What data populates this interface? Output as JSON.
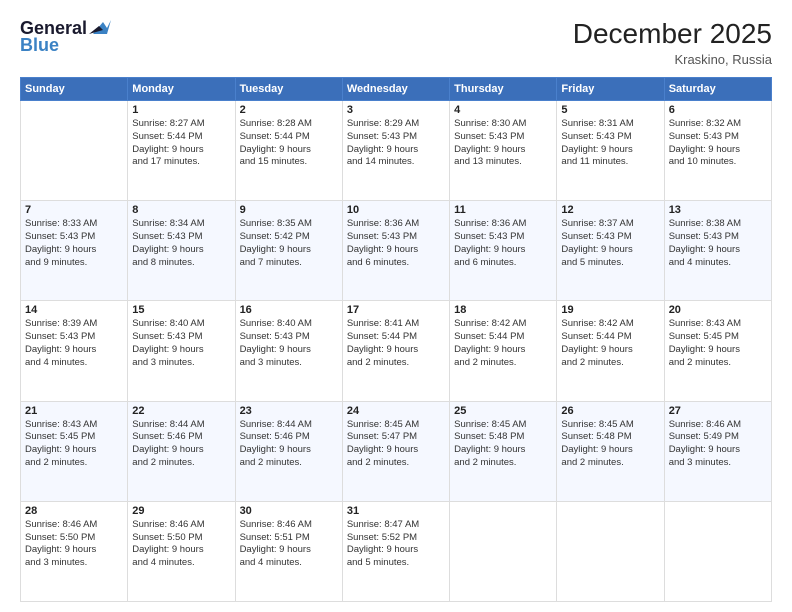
{
  "logo": {
    "line1": "General",
    "line2": "Blue"
  },
  "title": "December 2025",
  "location": "Kraskino, Russia",
  "days_of_week": [
    "Sunday",
    "Monday",
    "Tuesday",
    "Wednesday",
    "Thursday",
    "Friday",
    "Saturday"
  ],
  "weeks": [
    [
      {
        "day": "",
        "info": ""
      },
      {
        "day": "1",
        "info": "Sunrise: 8:27 AM\nSunset: 5:44 PM\nDaylight: 9 hours\nand 17 minutes."
      },
      {
        "day": "2",
        "info": "Sunrise: 8:28 AM\nSunset: 5:44 PM\nDaylight: 9 hours\nand 15 minutes."
      },
      {
        "day": "3",
        "info": "Sunrise: 8:29 AM\nSunset: 5:43 PM\nDaylight: 9 hours\nand 14 minutes."
      },
      {
        "day": "4",
        "info": "Sunrise: 8:30 AM\nSunset: 5:43 PM\nDaylight: 9 hours\nand 13 minutes."
      },
      {
        "day": "5",
        "info": "Sunrise: 8:31 AM\nSunset: 5:43 PM\nDaylight: 9 hours\nand 11 minutes."
      },
      {
        "day": "6",
        "info": "Sunrise: 8:32 AM\nSunset: 5:43 PM\nDaylight: 9 hours\nand 10 minutes."
      }
    ],
    [
      {
        "day": "7",
        "info": "Sunrise: 8:33 AM\nSunset: 5:43 PM\nDaylight: 9 hours\nand 9 minutes."
      },
      {
        "day": "8",
        "info": "Sunrise: 8:34 AM\nSunset: 5:43 PM\nDaylight: 9 hours\nand 8 minutes."
      },
      {
        "day": "9",
        "info": "Sunrise: 8:35 AM\nSunset: 5:42 PM\nDaylight: 9 hours\nand 7 minutes."
      },
      {
        "day": "10",
        "info": "Sunrise: 8:36 AM\nSunset: 5:43 PM\nDaylight: 9 hours\nand 6 minutes."
      },
      {
        "day": "11",
        "info": "Sunrise: 8:36 AM\nSunset: 5:43 PM\nDaylight: 9 hours\nand 6 minutes."
      },
      {
        "day": "12",
        "info": "Sunrise: 8:37 AM\nSunset: 5:43 PM\nDaylight: 9 hours\nand 5 minutes."
      },
      {
        "day": "13",
        "info": "Sunrise: 8:38 AM\nSunset: 5:43 PM\nDaylight: 9 hours\nand 4 minutes."
      }
    ],
    [
      {
        "day": "14",
        "info": "Sunrise: 8:39 AM\nSunset: 5:43 PM\nDaylight: 9 hours\nand 4 minutes."
      },
      {
        "day": "15",
        "info": "Sunrise: 8:40 AM\nSunset: 5:43 PM\nDaylight: 9 hours\nand 3 minutes."
      },
      {
        "day": "16",
        "info": "Sunrise: 8:40 AM\nSunset: 5:43 PM\nDaylight: 9 hours\nand 3 minutes."
      },
      {
        "day": "17",
        "info": "Sunrise: 8:41 AM\nSunset: 5:44 PM\nDaylight: 9 hours\nand 2 minutes."
      },
      {
        "day": "18",
        "info": "Sunrise: 8:42 AM\nSunset: 5:44 PM\nDaylight: 9 hours\nand 2 minutes."
      },
      {
        "day": "19",
        "info": "Sunrise: 8:42 AM\nSunset: 5:44 PM\nDaylight: 9 hours\nand 2 minutes."
      },
      {
        "day": "20",
        "info": "Sunrise: 8:43 AM\nSunset: 5:45 PM\nDaylight: 9 hours\nand 2 minutes."
      }
    ],
    [
      {
        "day": "21",
        "info": "Sunrise: 8:43 AM\nSunset: 5:45 PM\nDaylight: 9 hours\nand 2 minutes."
      },
      {
        "day": "22",
        "info": "Sunrise: 8:44 AM\nSunset: 5:46 PM\nDaylight: 9 hours\nand 2 minutes."
      },
      {
        "day": "23",
        "info": "Sunrise: 8:44 AM\nSunset: 5:46 PM\nDaylight: 9 hours\nand 2 minutes."
      },
      {
        "day": "24",
        "info": "Sunrise: 8:45 AM\nSunset: 5:47 PM\nDaylight: 9 hours\nand 2 minutes."
      },
      {
        "day": "25",
        "info": "Sunrise: 8:45 AM\nSunset: 5:48 PM\nDaylight: 9 hours\nand 2 minutes."
      },
      {
        "day": "26",
        "info": "Sunrise: 8:45 AM\nSunset: 5:48 PM\nDaylight: 9 hours\nand 2 minutes."
      },
      {
        "day": "27",
        "info": "Sunrise: 8:46 AM\nSunset: 5:49 PM\nDaylight: 9 hours\nand 3 minutes."
      }
    ],
    [
      {
        "day": "28",
        "info": "Sunrise: 8:46 AM\nSunset: 5:50 PM\nDaylight: 9 hours\nand 3 minutes."
      },
      {
        "day": "29",
        "info": "Sunrise: 8:46 AM\nSunset: 5:50 PM\nDaylight: 9 hours\nand 4 minutes."
      },
      {
        "day": "30",
        "info": "Sunrise: 8:46 AM\nSunset: 5:51 PM\nDaylight: 9 hours\nand 4 minutes."
      },
      {
        "day": "31",
        "info": "Sunrise: 8:47 AM\nSunset: 5:52 PM\nDaylight: 9 hours\nand 5 minutes."
      },
      {
        "day": "",
        "info": ""
      },
      {
        "day": "",
        "info": ""
      },
      {
        "day": "",
        "info": ""
      }
    ]
  ]
}
